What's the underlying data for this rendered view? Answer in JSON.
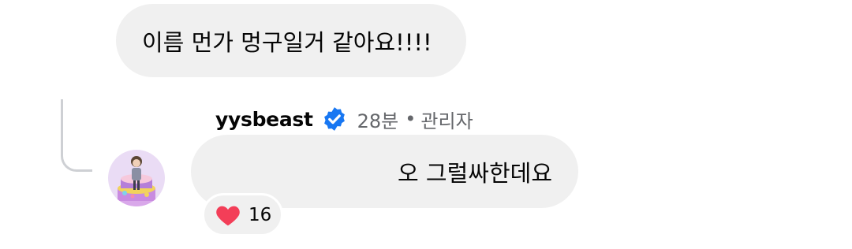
{
  "comment": {
    "text": "이름 먼가 멍구일거 같아요!!!!"
  },
  "reply": {
    "username": "yysbeast",
    "verified_icon": "verified-badge-icon",
    "time": "28분",
    "separator": "•",
    "role": "관리자",
    "text": "오 그럴싸한데요",
    "reaction_icon": "heart-icon",
    "reaction_count": "16"
  },
  "colors": {
    "bubble": "#f0f0f0",
    "verified": "#1877f2",
    "heart": "#f33e58",
    "meta": "#65676b",
    "thread_line": "#ced0d4"
  }
}
